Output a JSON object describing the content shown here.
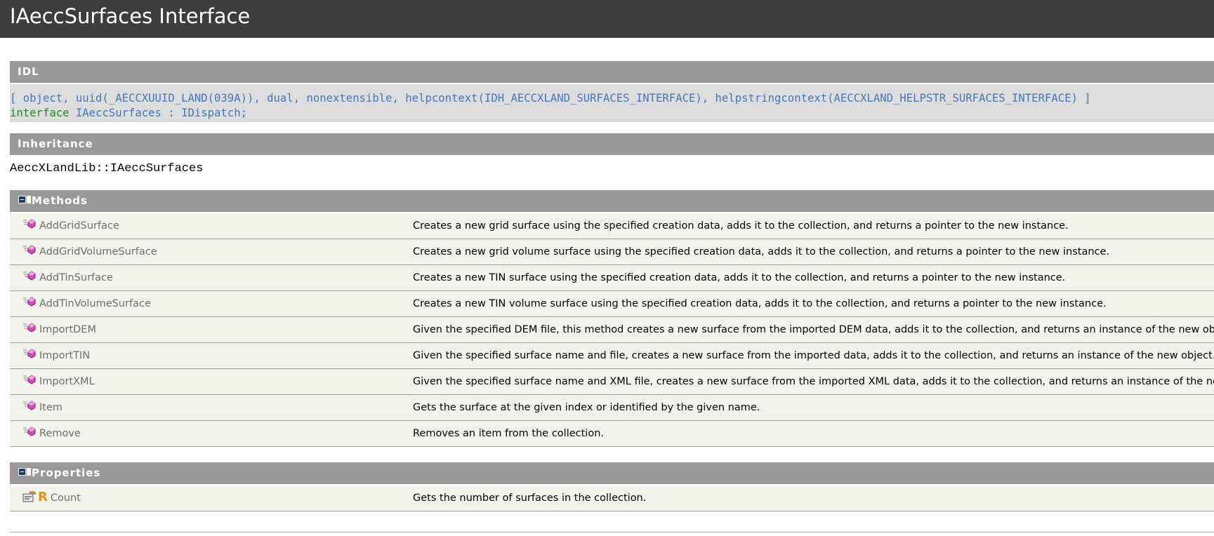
{
  "page": {
    "title": "IAeccSurfaces Interface"
  },
  "idl": {
    "header": "IDL",
    "line1": "[ object, uuid(_AECCXUUID_LAND(039A)), dual, nonextensible, helpcontext(IDH_AECCXLAND_SURFACES_INTERFACE), helpstringcontext(AECCXLAND_HELPSTR_SURFACES_INTERFACE) ]",
    "keyword": "interface",
    "declaration": " IAeccSurfaces : IDispatch;"
  },
  "inheritance": {
    "header": "Inheritance",
    "text": "AeccXLandLib::IAeccSurfaces"
  },
  "methods": {
    "header": "Methods",
    "items": [
      {
        "name": "AddGridSurface",
        "description": "Creates a new grid surface using the specified creation data, adds it to the collection, and returns a pointer to the new instance.",
        "icon": "method-icon"
      },
      {
        "name": "AddGridVolumeSurface",
        "description": "Creates a new grid volume surface using the specified creation data, adds it to the collection, and returns a pointer to the new instance.",
        "icon": "method-icon"
      },
      {
        "name": "AddTinSurface",
        "description": "Creates a new TIN surface using the specified creation data, adds it to the collection, and returns a pointer to the new instance.",
        "icon": "method-icon"
      },
      {
        "name": "AddTinVolumeSurface",
        "description": "Creates a new TIN volume surface using the specified creation data, adds it to the collection, and returns a pointer to the new instance.",
        "icon": "method-icon"
      },
      {
        "name": "ImportDEM",
        "description": "Given the specified DEM file, this method creates a new surface from the imported DEM data, adds it to the collection, and returns an instance of the new object.",
        "icon": "method-icon"
      },
      {
        "name": "ImportTIN",
        "description": "Given the specified surface name and file, creates a new surface from the imported data, adds it to the collection, and returns an instance of the new object.",
        "icon": "method-icon"
      },
      {
        "name": "ImportXML",
        "description": "Given the specified surface name and XML file, creates a new surface from the imported XML data, adds it to the collection, and returns an instance of the new object.",
        "icon": "method-icon"
      },
      {
        "name": "Item",
        "description": "Gets the surface at the given index or identified by the given name.",
        "icon": "method-icon"
      },
      {
        "name": "Remove",
        "description": "Removes an item from the collection.",
        "icon": "method-icon"
      }
    ]
  },
  "properties": {
    "header": "Properties",
    "items": [
      {
        "name": "Count",
        "badge": "R",
        "description": "Gets the number of surfaces in the collection.",
        "icon": "property-icon"
      }
    ]
  },
  "colors": {
    "title_bar": "#3d3d3d",
    "section_header": "#999999",
    "idl_background": "#dddddd",
    "idl_attribute": "#4477bb",
    "idl_keyword": "#228822",
    "row_background": "#f3f3ee",
    "member_name": "#6d6d6d",
    "readonly_badge": "#e0921a"
  }
}
